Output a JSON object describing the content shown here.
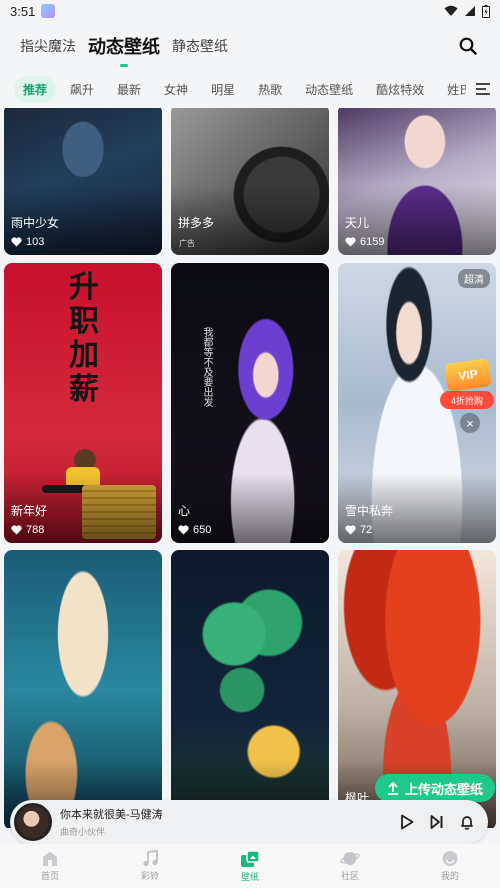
{
  "status_bar": {
    "time": "3:51"
  },
  "header": {
    "tabs": [
      {
        "label": "指尖魔法",
        "active": false
      },
      {
        "label": "动态壁纸",
        "active": true
      },
      {
        "label": "静态壁纸",
        "active": false
      }
    ]
  },
  "categories": [
    "推荐",
    "飙升",
    "最新",
    "女神",
    "明星",
    "热歌",
    "动态壁纸",
    "酷炫特效",
    "姓氏"
  ],
  "cards": [
    {
      "title": "雨中少女",
      "likes": "103",
      "icon": "heart-icon"
    },
    {
      "title": "拼多多",
      "ad_label": "广告",
      "icon": ""
    },
    {
      "title": "天儿",
      "likes": "6159",
      "icon": "heart-icon"
    },
    {
      "title": "新年好",
      "likes": "788",
      "poster_text": "升职加薪",
      "icon": "heart-icon"
    },
    {
      "title": "心",
      "likes": "650",
      "poster_text": "我都等不及要出发",
      "icon": "heart-icon"
    },
    {
      "title": "雪中私奔",
      "likes": "72",
      "badge": "超清",
      "icon": "heart-icon"
    },
    {
      "title": "",
      "likes": "",
      "icon": ""
    },
    {
      "title": "",
      "likes": "",
      "icon": ""
    },
    {
      "title": "枫叶",
      "likes": "",
      "icon": ""
    }
  ],
  "promo": {
    "vip_label": "VIP",
    "deal_label": "4折抢购"
  },
  "upload_button": {
    "label": "上传动态壁纸"
  },
  "player": {
    "song": "你本来就很美-马健涛",
    "artist": "曲奇小伙伴"
  },
  "bottom_nav": [
    {
      "label": "首页",
      "icon": "home-icon",
      "active": false
    },
    {
      "label": "彩铃",
      "icon": "music-note-icon",
      "active": false
    },
    {
      "label": "壁纸",
      "icon": "wallpaper-icon",
      "active": true
    },
    {
      "label": "社区",
      "icon": "community-icon",
      "active": false
    },
    {
      "label": "我的",
      "icon": "profile-icon",
      "active": false
    }
  ],
  "colors": {
    "accent": "#1fc98a",
    "active_chip_bg": "#dff5ec",
    "background": "#f4f5f7"
  }
}
